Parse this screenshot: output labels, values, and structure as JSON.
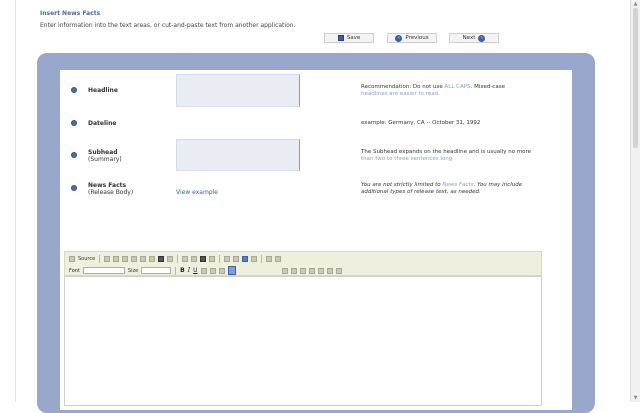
{
  "header": {
    "title": "Insert News Facts",
    "instructions": "Enter information into the text areas, or cut-and-paste text from another application."
  },
  "buttons": {
    "save": "Save",
    "previous": "Previous",
    "next": "Next"
  },
  "fields": {
    "headline": {
      "label": "Headline",
      "hint_line1_a": "Recommendation: Do not use ",
      "hint_line1_b": "ALL CAPS",
      "hint_line1_c": ". Mixed-case",
      "hint_line2": "headlines are easier to read."
    },
    "dateline": {
      "label": "Dateline",
      "hint": "example: Germany, CA -- October 31, 1992"
    },
    "subhead": {
      "label": "Subhead",
      "sublabel": "(Summary)",
      "hint_line1": "The Subhead expands on the headline and is usually no more",
      "hint_line2": "than two to three sentences long."
    },
    "news_facts": {
      "label": "News Facts",
      "sublabel": "(Release Body)",
      "link": "View example",
      "hint_line1_a": "You are not strictly limited to ",
      "hint_line1_b": "News Facts",
      "hint_line1_c": ". You may include",
      "hint_line2": "additional types of release text, as needed."
    }
  },
  "toolbar": {
    "source": "Source",
    "font": "Font",
    "size": "Size",
    "bold": "B",
    "italic": "I",
    "underline": "U"
  },
  "colors": {
    "frame": "#9aa7cc",
    "field": "#e9edf3",
    "accent": "#3b5fa8",
    "toolbar": "#efefde"
  }
}
